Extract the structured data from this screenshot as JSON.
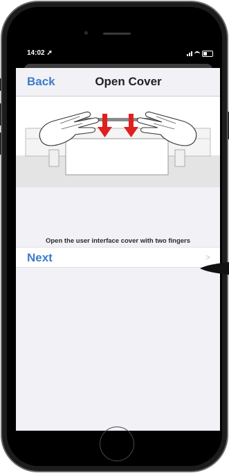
{
  "status_bar": {
    "time": "14:02"
  },
  "nav": {
    "back_label": "Back",
    "title": "Open Cover"
  },
  "instruction": {
    "caption": "Open the user interface cover with two fingers"
  },
  "actions": {
    "next_label": "Next",
    "next_chevron": ">"
  },
  "icons": {
    "location": "location-arrow-icon",
    "signal": "cellular-signal-icon",
    "wifi": "wifi-icon",
    "battery": "battery-icon",
    "chevron": "chevron-right-icon"
  },
  "colors": {
    "accent": "#3d7cc9",
    "arrow": "#e02020",
    "background": "#f1f1f6"
  }
}
